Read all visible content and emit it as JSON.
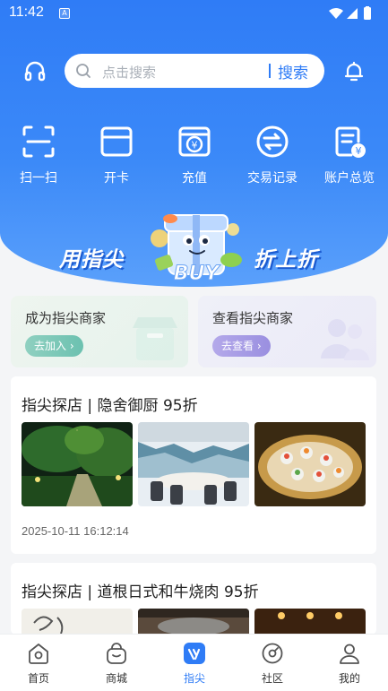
{
  "status_bar": {
    "time": "11:42",
    "indicator": "A"
  },
  "search": {
    "placeholder": "点击搜索",
    "button_label": "搜索"
  },
  "quick_actions": [
    {
      "label": "扫一扫",
      "icon": "scan-icon"
    },
    {
      "label": "开卡",
      "icon": "card-icon"
    },
    {
      "label": "充值",
      "icon": "recharge-icon"
    },
    {
      "label": "交易记录",
      "icon": "transaction-icon"
    },
    {
      "label": "账户总览",
      "icon": "account-overview-icon"
    }
  ],
  "banner": {
    "left_text": "用指尖",
    "right_text": "折上折",
    "badge_text": "BUY"
  },
  "merchant_cards": [
    {
      "title": "成为指尖商家",
      "button": "去加入 ›"
    },
    {
      "title": "查看指尖商家",
      "button": "去查看 ›"
    }
  ],
  "feed": [
    {
      "title": "指尖探店 | 隐舍御厨  95折",
      "time": "2025-10-11 16:12:14",
      "images": [
        "garden-night-photo",
        "banquet-room-photo",
        "sushi-platter-photo"
      ]
    },
    {
      "title": "指尖探店 | 道根日式和牛烧肉 95折",
      "images": [
        "calligraphy-photo",
        "grill-table-photo",
        "restaurant-interior-photo"
      ]
    }
  ],
  "tabbar": [
    {
      "label": "首页",
      "icon": "home-icon"
    },
    {
      "label": "商城",
      "icon": "shop-bag-icon"
    },
    {
      "label": "指尖",
      "icon": "fingertip-icon",
      "active": true
    },
    {
      "label": "社区",
      "icon": "community-icon"
    },
    {
      "label": "我的",
      "icon": "profile-icon"
    }
  ],
  "colors": {
    "primary": "#2f7cf6",
    "background": "#f4f5f7"
  }
}
